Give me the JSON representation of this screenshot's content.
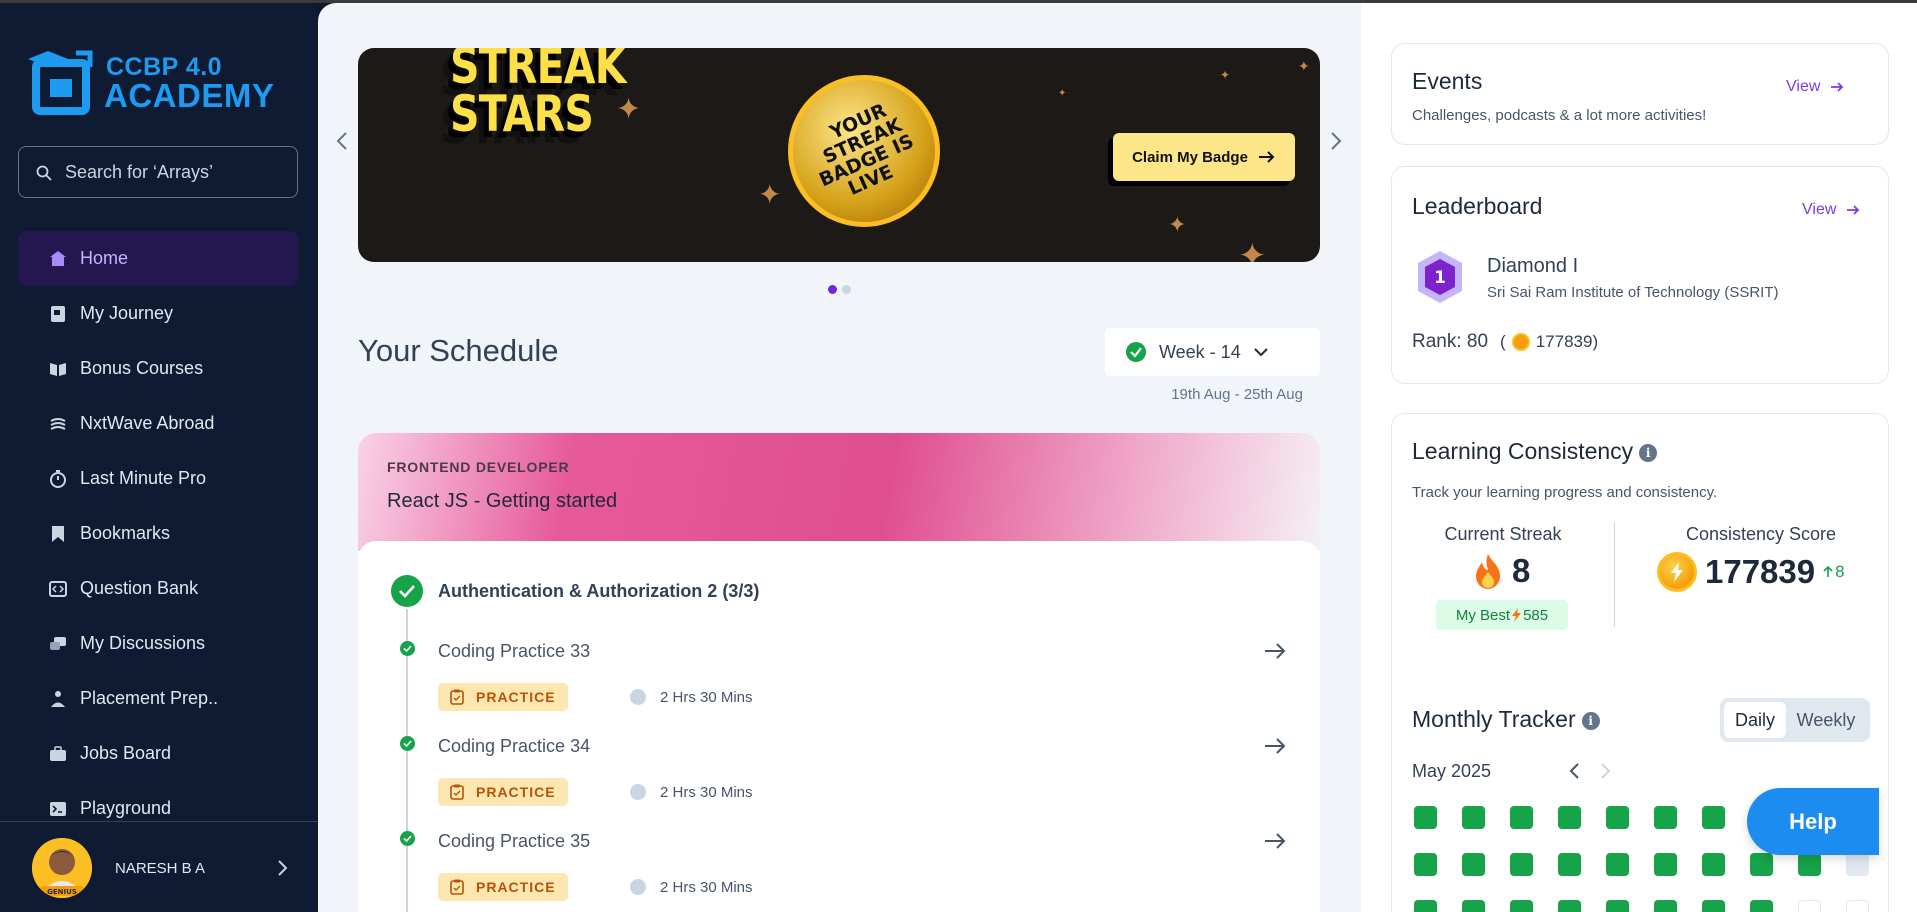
{
  "brand": {
    "line1": "CCBP 4.0",
    "line2": "ACADEMY",
    "color": "#1d9bf0"
  },
  "search": {
    "placeholder": "Search for ‘Arrays’"
  },
  "nav": [
    {
      "label": "Home",
      "icon": "home-icon",
      "active": true
    },
    {
      "label": "My Journey",
      "icon": "journey-icon"
    },
    {
      "label": "Bonus Courses",
      "icon": "book-icon"
    },
    {
      "label": "NxtWave Abroad",
      "icon": "globe-icon"
    },
    {
      "label": "Last Minute Pro",
      "icon": "stopwatch-icon"
    },
    {
      "label": "Bookmarks",
      "icon": "bookmark-icon"
    },
    {
      "label": "Question Bank",
      "icon": "code-icon"
    },
    {
      "label": "My Discussions",
      "icon": "discussion-icon"
    },
    {
      "label": "Placement Prep..",
      "icon": "person-icon"
    },
    {
      "label": "Jobs Board",
      "icon": "briefcase-icon"
    },
    {
      "label": "Playground",
      "icon": "terminal-icon"
    }
  ],
  "user": {
    "name": "NARESH B A",
    "badge": "GENIUS"
  },
  "banner": {
    "title_line1": "STREAK",
    "title_line2": "STARS",
    "coin_line1": "YOUR",
    "coin_line2": "STREAK",
    "coin_line3": "BADGE IS",
    "coin_line4": "LIVE",
    "cta": "Claim My Badge"
  },
  "schedule": {
    "title": "Your Schedule",
    "week": "Week - 14",
    "range": "19th Aug - 25th Aug",
    "course": {
      "track": "FRONTEND DEVELOPER",
      "name": "React JS - Getting started",
      "unit": "Authentication & Authorization 2 (3/3)",
      "items": [
        {
          "title": "Coding Practice 33",
          "tag": "PRACTICE",
          "duration": "2 Hrs 30 Mins"
        },
        {
          "title": "Coding Practice 34",
          "tag": "PRACTICE",
          "duration": "2 Hrs 30 Mins"
        },
        {
          "title": "Coding Practice 35",
          "tag": "PRACTICE",
          "duration": "2 Hrs 30 Mins"
        }
      ]
    }
  },
  "events": {
    "title": "Events",
    "view": "View",
    "subtitle": "Challenges, podcasts & a lot more activities!"
  },
  "leaderboard": {
    "title": "Leaderboard",
    "view": "View",
    "tier_number": "1",
    "tier": "Diamond I",
    "college": "Sri Sai Ram Institute of Technology (SSRIT)",
    "rank_label": "Rank: 80",
    "rank_open": "(",
    "points": "177839)"
  },
  "consistency": {
    "title": "Learning Consistency",
    "subtitle": "Track your learning progress and consistency.",
    "streak_label": "Current Streak",
    "streak": "8",
    "best_label": "My Best",
    "best": "585",
    "score_label": "Consistency Score",
    "score": "177839",
    "gain": "8"
  },
  "tracker": {
    "title": "Monthly Tracker",
    "daily": "Daily",
    "weekly": "Weekly",
    "month": "May 2025"
  },
  "help": "Help",
  "colors": {
    "accent": "#7c3aed",
    "success": "#16a34a",
    "sidebar": "#0f1a33"
  }
}
